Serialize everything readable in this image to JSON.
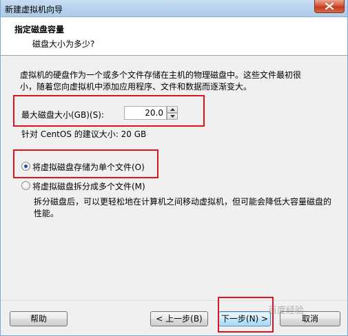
{
  "window": {
    "title": "新建虚拟机向导"
  },
  "header": {
    "title": "指定磁盘容量",
    "subtitle": "磁盘大小为多少?"
  },
  "description": {
    "line1": "虚拟机的硬盘作为一个或多个文件存储在主机的物理磁盘中。这些文件最初很",
    "line2": "小，随着您向虚拟机中添加应用程序、文件和数据而逐渐变大。"
  },
  "disk_size": {
    "label": "最大磁盘大小(GB)(S):",
    "value": "20.0",
    "recommendation": "针对 CentOS 的建议大小: 20 GB"
  },
  "storage_options": {
    "single_file": {
      "label": "将虚拟磁盘存储为单个文件(O)",
      "checked": true
    },
    "split_files": {
      "label": "将虚拟磁盘拆分成多个文件(M)",
      "checked": false,
      "desc_line1": "拆分磁盘后，可以更轻松地在计算机之间移动虚拟机，但可能会降低大容量磁盘的",
      "desc_line2": "性能。"
    }
  },
  "buttons": {
    "help": "帮助",
    "back": "< 上一步(B)",
    "next": "下一步(N) >",
    "cancel": "取消"
  },
  "watermark": "百度经验",
  "colors": {
    "highlight_box": "#e0121b",
    "radio_dot": "#1f4d9e"
  }
}
